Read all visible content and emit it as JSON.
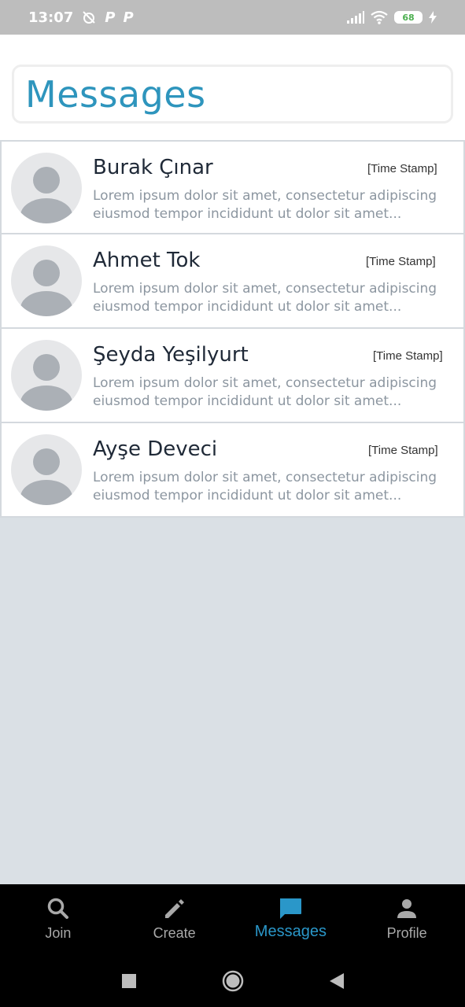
{
  "status_bar": {
    "time": "13:07",
    "p1": "P",
    "p2": "P",
    "battery": "68"
  },
  "header": {
    "title": "Messages"
  },
  "conversations": [
    {
      "name": "Burak Çınar",
      "timestamp": "[Time Stamp]",
      "line1": "Lorem ipsum dolor sit amet, consectetur adipiscing",
      "line2": "eiusmod tempor incididunt ut dolor sit amet..."
    },
    {
      "name": "Ahmet Tok",
      "timestamp": "[Time Stamp]",
      "line1": "Lorem ipsum dolor sit amet, consectetur adipiscing",
      "line2": "eiusmod tempor incididunt ut dolor sit amet..."
    },
    {
      "name": "Şeyda Yeşilyurt",
      "timestamp": "[Time Stamp]",
      "line1": "Lorem ipsum dolor sit amet, consectetur adipiscing",
      "line2": "eiusmod tempor incididunt ut dolor sit amet..."
    },
    {
      "name": "Ayşe Deveci",
      "timestamp": "[Time Stamp]",
      "line1": "Lorem ipsum dolor sit amet, consectetur adipiscing",
      "line2": "eiusmod tempor incididunt ut dolor sit amet..."
    }
  ],
  "bottom_nav": {
    "items": [
      {
        "label": "Join",
        "icon": "search-icon"
      },
      {
        "label": "Create",
        "icon": "pencil-icon"
      },
      {
        "label": "Messages",
        "icon": "chat-icon",
        "active": true
      },
      {
        "label": "Profile",
        "icon": "person-icon"
      }
    ]
  },
  "colors": {
    "accent": "#2a97c9",
    "title": "#2e95bd",
    "background": "#dae0e5",
    "preview_text": "#8c96a0"
  }
}
